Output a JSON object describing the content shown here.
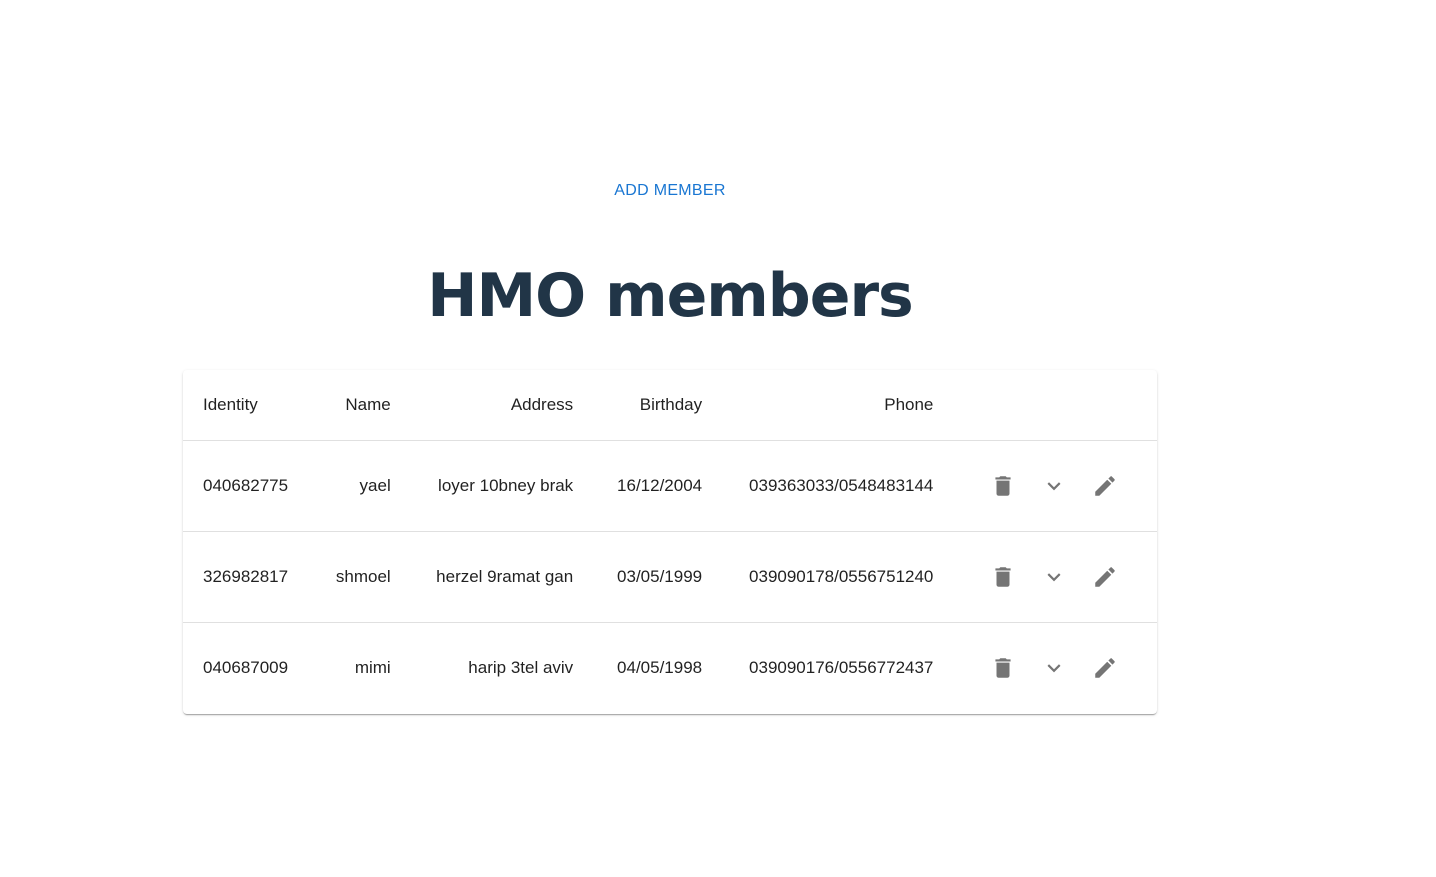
{
  "add_member_label": "ADD MEMBER",
  "page_title": "HMO members",
  "table": {
    "headers": {
      "identity": "Identity",
      "name": "Name",
      "address": "Address",
      "birthday": "Birthday",
      "phone": "Phone"
    },
    "rows": [
      {
        "identity": "040682775",
        "name": "yael",
        "address": "loyer 10bney brak",
        "birthday": "16/12/2004",
        "phone": "039363033/0548483144"
      },
      {
        "identity": "326982817",
        "name": "shmoel",
        "address": "herzel 9ramat gan",
        "birthday": "03/05/1999",
        "phone": "039090178/0556751240"
      },
      {
        "identity": "040687009",
        "name": "mimi",
        "address": "harip 3tel aviv",
        "birthday": "04/05/1998",
        "phone": "039090176/0556772437"
      }
    ],
    "row_actions": [
      "delete-icon",
      "expand-more-icon",
      "edit-icon"
    ]
  },
  "colors": {
    "accent": "#1976d2",
    "title": "#213547",
    "icon": "#757575"
  }
}
